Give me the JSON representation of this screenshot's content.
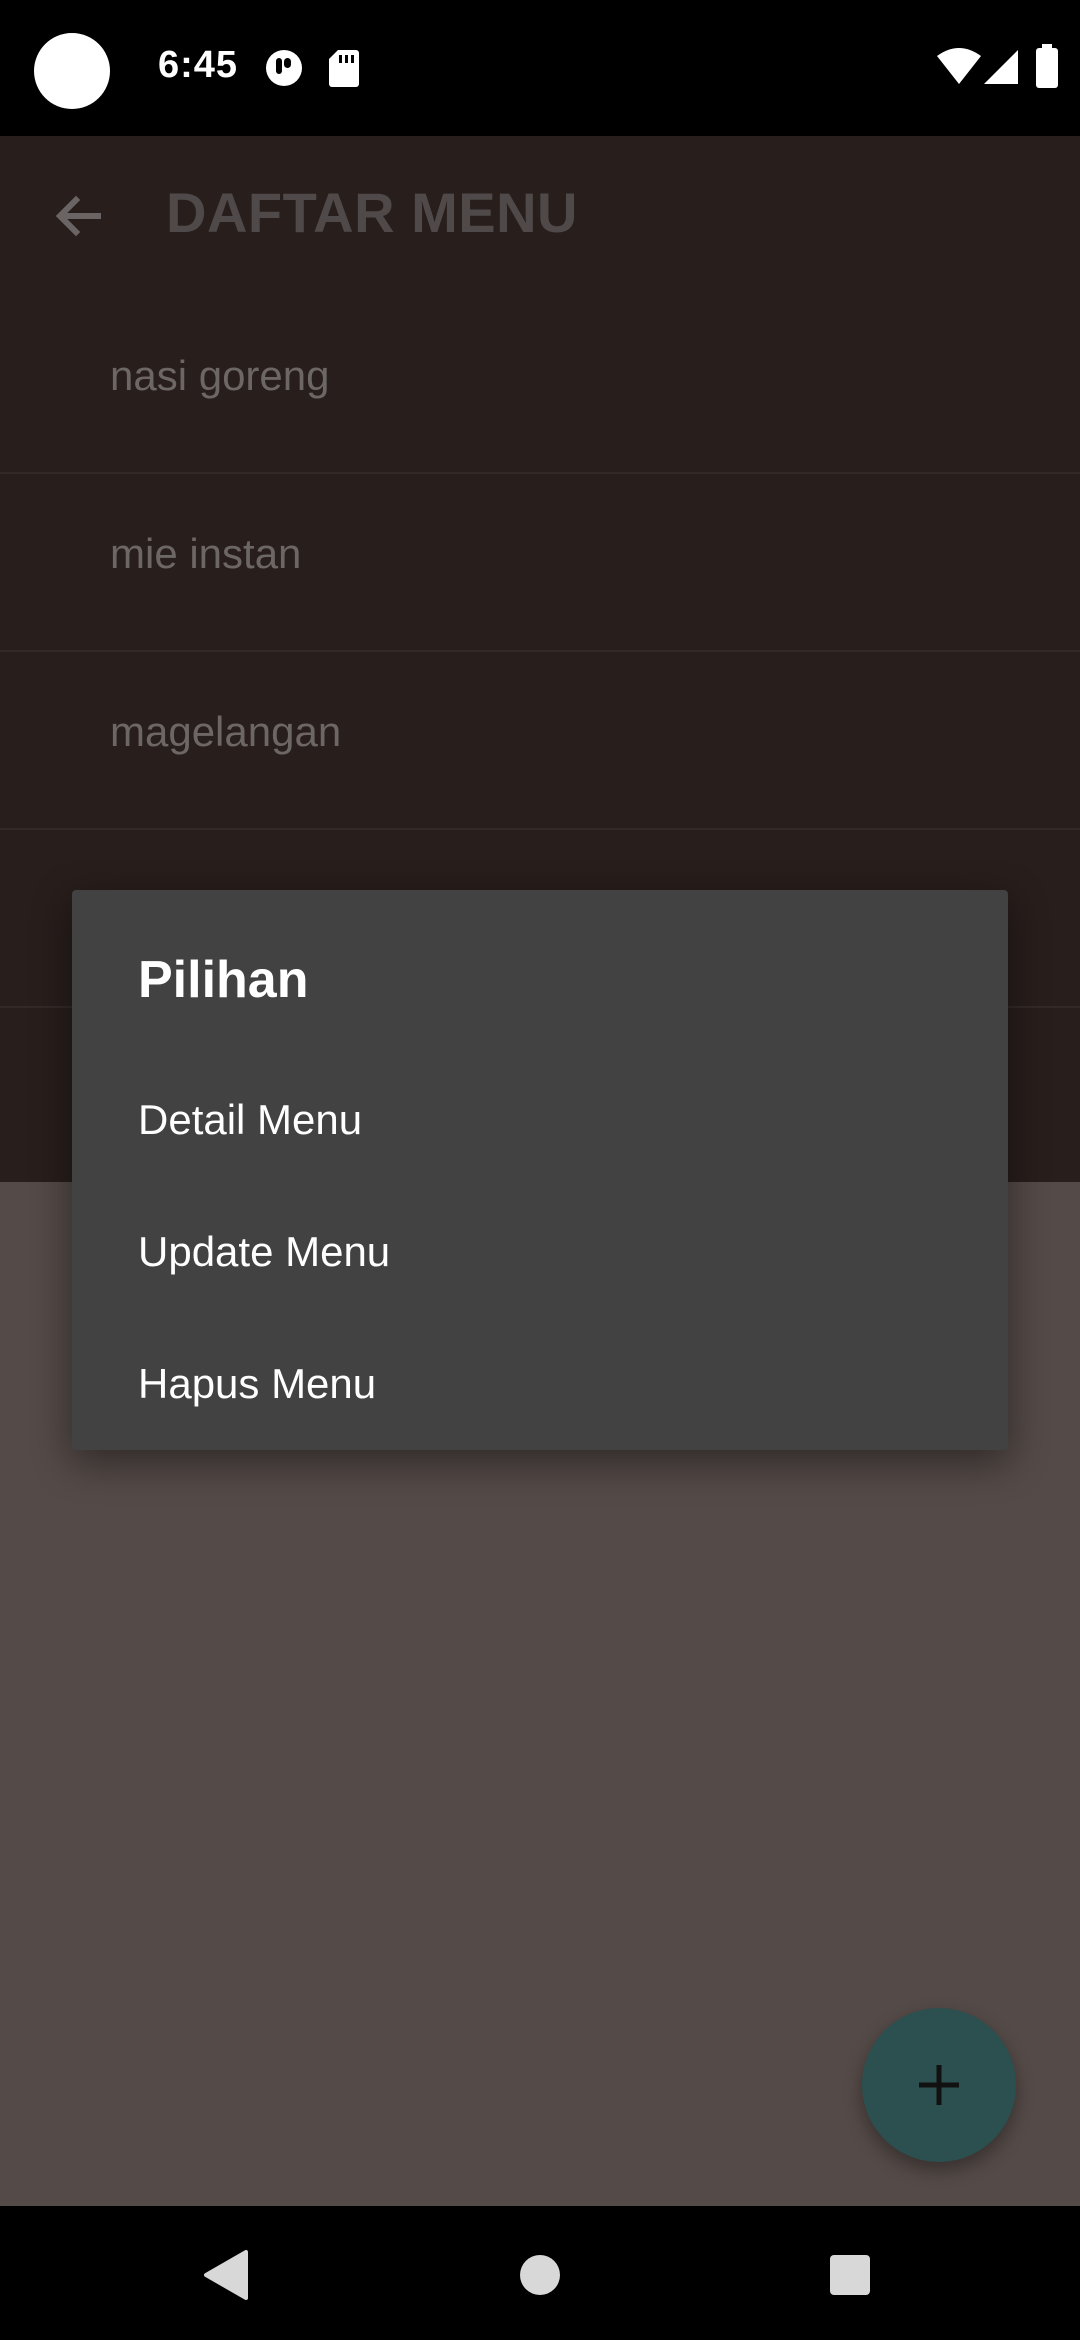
{
  "status_bar": {
    "time": "6:45",
    "icons": [
      "notification-icon",
      "sd-card-icon",
      "wifi-icon",
      "cellular-signal-icon",
      "battery-icon"
    ]
  },
  "app_bar": {
    "title": "DAFTAR MENU",
    "back_icon": "arrow-back-icon"
  },
  "menu_list": {
    "items": [
      {
        "label": "nasi goreng"
      },
      {
        "label": "mie instan"
      },
      {
        "label": "magelangan"
      },
      {
        "label": ""
      },
      {
        "label": ""
      }
    ]
  },
  "dialog": {
    "title": "Pilihan",
    "options": [
      {
        "label": "Detail Menu"
      },
      {
        "label": "Update Menu"
      },
      {
        "label": "Hapus Menu"
      }
    ]
  },
  "fab": {
    "icon": "plus-icon",
    "color": "#2c4f4f"
  },
  "nav_bar": {
    "buttons": [
      "back-nav-icon",
      "home-nav-icon",
      "recents-nav-icon"
    ]
  },
  "colors": {
    "scrim_top": "#281e1c",
    "scrim_bottom": "#544a47",
    "dialog_bg": "#424242"
  }
}
